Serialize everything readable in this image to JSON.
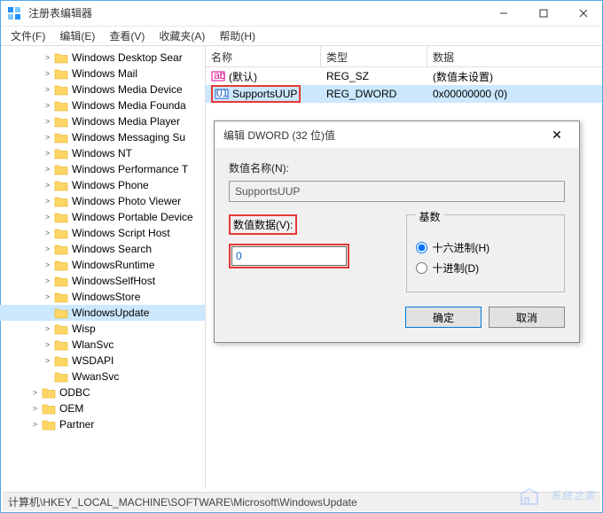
{
  "window": {
    "title": "注册表编辑器"
  },
  "menu": {
    "file": "文件(F)",
    "edit": "编辑(E)",
    "view": "查看(V)",
    "fav": "收藏夹(A)",
    "help": "帮助(H)"
  },
  "tree": {
    "items": [
      {
        "label": "Windows Desktop Sear",
        "indent": 48,
        "exp": ">"
      },
      {
        "label": "Windows Mail",
        "indent": 48,
        "exp": ">"
      },
      {
        "label": "Windows Media Device",
        "indent": 48,
        "exp": ">"
      },
      {
        "label": "Windows Media Founda",
        "indent": 48,
        "exp": ">"
      },
      {
        "label": "Windows Media Player",
        "indent": 48,
        "exp": ">"
      },
      {
        "label": "Windows Messaging Su",
        "indent": 48,
        "exp": ">"
      },
      {
        "label": "Windows NT",
        "indent": 48,
        "exp": ">"
      },
      {
        "label": "Windows Performance T",
        "indent": 48,
        "exp": ">"
      },
      {
        "label": "Windows Phone",
        "indent": 48,
        "exp": ">"
      },
      {
        "label": "Windows Photo Viewer",
        "indent": 48,
        "exp": ">"
      },
      {
        "label": "Windows Portable Device",
        "indent": 48,
        "exp": ">"
      },
      {
        "label": "Windows Script Host",
        "indent": 48,
        "exp": ">"
      },
      {
        "label": "Windows Search",
        "indent": 48,
        "exp": ">"
      },
      {
        "label": "WindowsRuntime",
        "indent": 48,
        "exp": ">"
      },
      {
        "label": "WindowsSelfHost",
        "indent": 48,
        "exp": ">"
      },
      {
        "label": "WindowsStore",
        "indent": 48,
        "exp": ">"
      },
      {
        "label": "WindowsUpdate",
        "indent": 48,
        "exp": "",
        "selected": true
      },
      {
        "label": "Wisp",
        "indent": 48,
        "exp": ">"
      },
      {
        "label": "WlanSvc",
        "indent": 48,
        "exp": ">"
      },
      {
        "label": "WSDAPI",
        "indent": 48,
        "exp": ">"
      },
      {
        "label": "WwanSvc",
        "indent": 48,
        "exp": ""
      },
      {
        "label": "ODBC",
        "indent": 34,
        "exp": ">"
      },
      {
        "label": "OEM",
        "indent": 34,
        "exp": ">"
      },
      {
        "label": "Partner",
        "indent": 34,
        "exp": ">"
      }
    ]
  },
  "list": {
    "cols": {
      "name": "名称",
      "type": "类型",
      "data": "数据"
    },
    "rows": [
      {
        "name": "(默认)",
        "type": "REG_SZ",
        "data": "(数值未设置)",
        "icon": "ab",
        "selected": false,
        "red": false
      },
      {
        "name": "SupportsUUP",
        "type": "REG_DWORD",
        "data": "0x00000000 (0)",
        "icon": "010",
        "selected": true,
        "red": true
      }
    ]
  },
  "dialog": {
    "title": "编辑 DWORD (32 位)值",
    "nameLabel": "数值名称(N):",
    "nameValue": "SupportsUUP",
    "dataLabel": "数值数据(V):",
    "dataValue": "0",
    "baseLabel": "基数",
    "hex": "十六进制(H)",
    "dec": "十进制(D)",
    "ok": "确定",
    "cancel": "取消"
  },
  "statusbar": {
    "path": "计算机\\HKEY_LOCAL_MACHINE\\SOFTWARE\\Microsoft\\WindowsUpdate"
  },
  "watermark": {
    "text": "系统之家"
  }
}
